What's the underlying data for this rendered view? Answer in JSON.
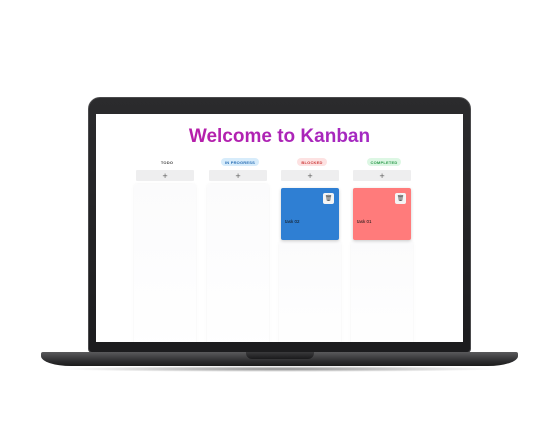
{
  "app": {
    "title": "Welcome to Kanban"
  },
  "columns": [
    {
      "label": "TODO",
      "header_bg": "#ffffff",
      "header_color": "#444444",
      "add_label": "+",
      "cards": []
    },
    {
      "label": "IN PROGRESS",
      "header_bg": "#d7ecfb",
      "header_color": "#2a6fb5",
      "add_label": "+",
      "cards": []
    },
    {
      "label": "BLOCKED",
      "header_bg": "#fde2e2",
      "header_color": "#cc3a3a",
      "add_label": "+",
      "cards": [
        {
          "text": "task 02",
          "color": "#2f7fd3",
          "delete_icon": "trash-icon"
        }
      ]
    },
    {
      "label": "COMPLETED",
      "header_bg": "#ddf7e4",
      "header_color": "#2a9a4a",
      "add_label": "+",
      "cards": [
        {
          "text": "task 01",
          "color": "#ff7b7b",
          "delete_icon": "trash-icon"
        }
      ]
    }
  ]
}
